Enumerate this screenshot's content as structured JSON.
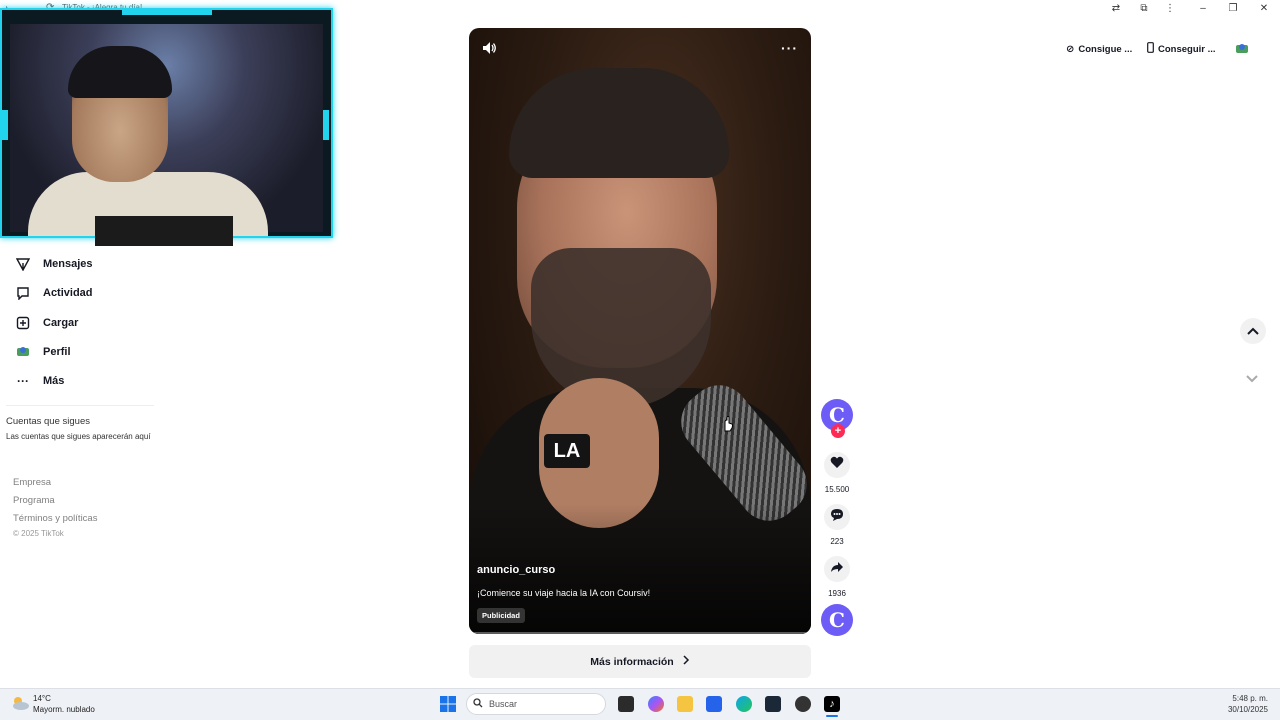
{
  "window": {
    "tab_title": "TikTok - ¡Alegra tu día!"
  },
  "sidebar": {
    "items": [
      {
        "label": "Mensajes",
        "icon": "send-icon"
      },
      {
        "label": "Actividad",
        "icon": "inbox-icon"
      },
      {
        "label": "Cargar",
        "icon": "upload-icon"
      },
      {
        "label": "Perfil",
        "icon": "avatar-icon"
      },
      {
        "label": "Más",
        "icon": "more-dots-icon"
      }
    ],
    "following_title": "Cuentas que sigues",
    "following_subtitle": "Las cuentas que sigues aparecerán aquí",
    "footer_links": [
      "Empresa",
      "Programa",
      "Términos y políticas"
    ],
    "copyright": "© 2025 TikTok"
  },
  "video": {
    "overlay_text": "LA",
    "author": "anuncio_curso",
    "caption": "¡Comience su viaje hacia la IA con Coursiv!",
    "ad_label": "Publicidad"
  },
  "more_info_label": "Más información",
  "actions": {
    "avatar_letter": "C",
    "likes": "15.500",
    "comments": "223",
    "shares": "1936"
  },
  "top_right": {
    "get_coins": "Consigue ...",
    "get_app": "Conseguir ..."
  },
  "taskbar": {
    "weather_temp": "14°C",
    "weather_desc": "Mayorm. nublado",
    "search_placeholder": "Buscar",
    "time": "5:48 p. m.",
    "date": "30/10/2025"
  },
  "colors": {
    "accent_pink": "#fe2c55",
    "avatar_purple": "#6d5cf6",
    "webcam_border": "#22d3ee"
  }
}
